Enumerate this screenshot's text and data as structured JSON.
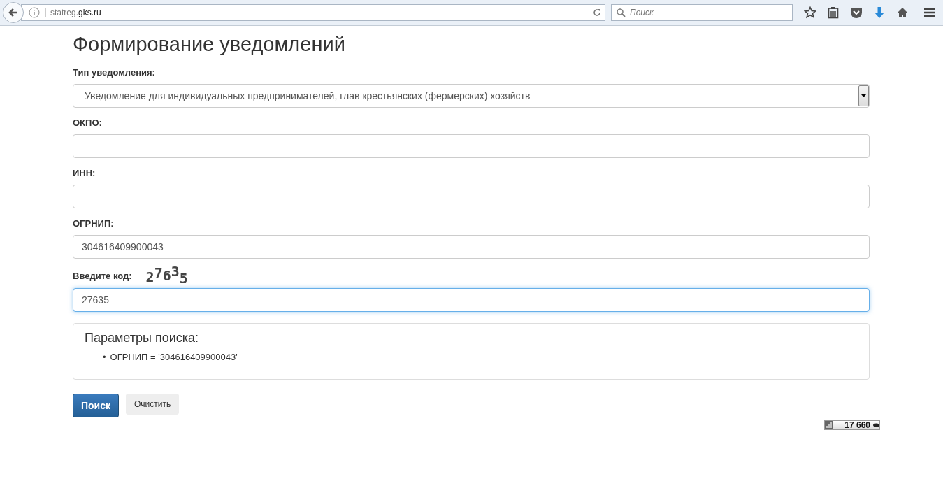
{
  "browser": {
    "url_prefix": "statreg.",
    "url_domain": "gks.ru",
    "search_placeholder": "Поиск"
  },
  "page": {
    "title": "Формирование уведомлений",
    "fields": [
      {
        "kind": "select",
        "label": "Тип уведомления:",
        "value": "Уведомление для индивидуальных предпринимателей, глав крестьянских (фермерских) хозяйств"
      },
      {
        "kind": "input",
        "label": "ОКПО:"
      },
      {
        "kind": "input",
        "label": "ИНН:"
      },
      {
        "kind": "input",
        "label": "ОГРНИП:",
        "value": "304616409900043"
      },
      {
        "kind": "captcha",
        "label": "Введите код:",
        "captcha": "27635",
        "value": "27635",
        "focused": true
      }
    ],
    "params": {
      "title": "Параметры поиска:",
      "items": [
        {
          "marker": "•",
          "text": "ОГРНИП = '304616409900043'"
        }
      ]
    },
    "buttons": [
      {
        "label": "Поиск",
        "primary": true
      },
      {
        "label": "Очистить",
        "primary": false
      }
    ],
    "counter": "17 660"
  }
}
